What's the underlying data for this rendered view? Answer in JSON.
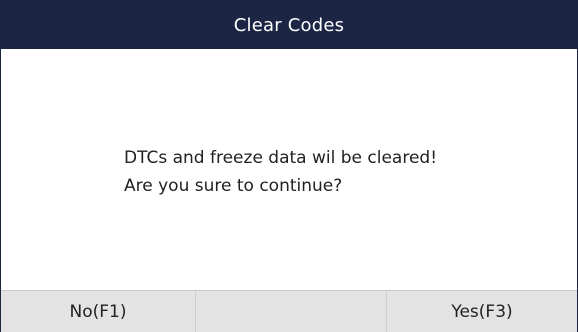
{
  "header": {
    "title": "Clear Codes"
  },
  "dialog": {
    "line1": "DTCs and freeze data wil be cleared!",
    "line2": "Are you sure to continue?"
  },
  "footer": {
    "f1_label": "No(F1)",
    "f2_label": "",
    "f3_label": "Yes(F3)"
  },
  "colors": {
    "header_bg": "#1c2543",
    "footer_bg": "#e3e3e3"
  }
}
